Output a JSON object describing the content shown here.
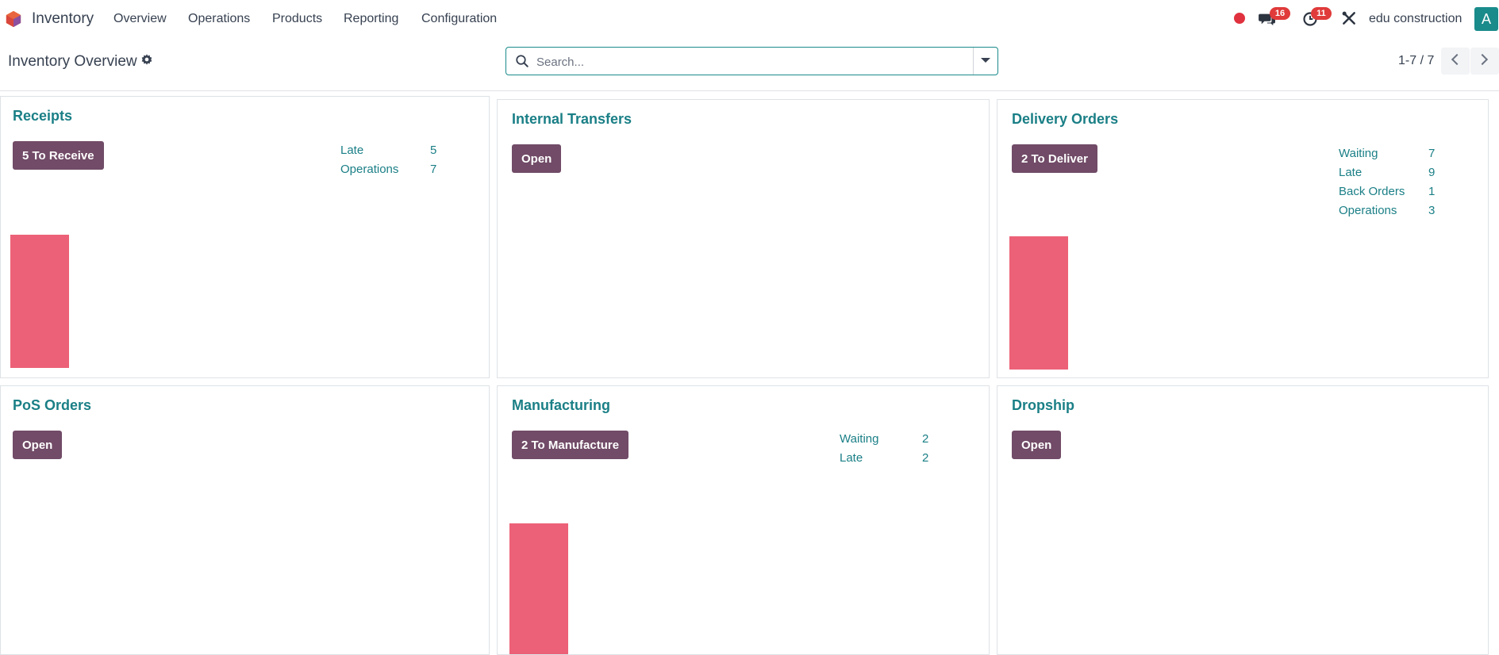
{
  "navbar": {
    "app_name": "Inventory",
    "menu": [
      "Overview",
      "Operations",
      "Products",
      "Reporting",
      "Configuration"
    ],
    "chat_badge": "16",
    "activity_badge": "11",
    "company": "edu construction",
    "avatar_letter": "A"
  },
  "control_panel": {
    "title": "Inventory Overview",
    "search_placeholder": "Search...",
    "pager": "1-7 / 7"
  },
  "colors": {
    "accent": "#1a7f86",
    "button": "#714b67",
    "bar": "#ec6177",
    "badge": "#e03a3a"
  },
  "cards": [
    {
      "title": "Receipts",
      "button": "5 To Receive",
      "stats": [
        {
          "label": "Late",
          "value": "5"
        },
        {
          "label": "Operations",
          "value": "7"
        }
      ]
    },
    {
      "title": "Internal Transfers",
      "button": "Open",
      "stats": []
    },
    {
      "title": "Delivery Orders",
      "button": "2 To Deliver",
      "stats": [
        {
          "label": "Waiting",
          "value": "7"
        },
        {
          "label": "Late",
          "value": "9"
        },
        {
          "label": "Back Orders",
          "value": "1"
        },
        {
          "label": "Operations",
          "value": "3"
        }
      ]
    },
    {
      "title": "PoS Orders",
      "button": "Open",
      "stats": []
    },
    {
      "title": "Manufacturing",
      "button": "2 To Manufacture",
      "stats": [
        {
          "label": "Waiting",
          "value": "2"
        },
        {
          "label": "Late",
          "value": "2"
        }
      ]
    },
    {
      "title": "Dropship",
      "button": "Open",
      "stats": []
    }
  ]
}
